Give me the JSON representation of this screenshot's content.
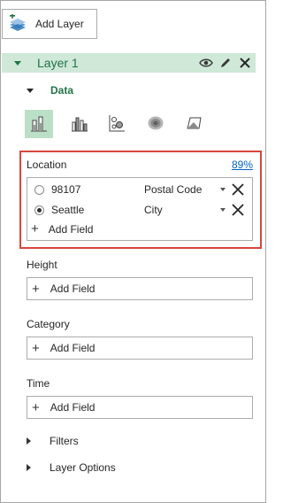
{
  "toolbar": {
    "add_layer_label": "Add Layer"
  },
  "layer": {
    "name": "Layer 1"
  },
  "data_section": {
    "label": "Data"
  },
  "viz_types": [
    {
      "icon": "stacked-column-icon",
      "selected": true
    },
    {
      "icon": "clustered-column-icon",
      "selected": false
    },
    {
      "icon": "bubble-icon",
      "selected": false
    },
    {
      "icon": "heat-map-icon",
      "selected": false
    },
    {
      "icon": "region-icon",
      "selected": false
    }
  ],
  "location": {
    "label": "Location",
    "confidence": "89%",
    "rows": [
      {
        "value": "98107",
        "type": "Postal Code",
        "selected": false
      },
      {
        "value": "Seattle",
        "type": "City",
        "selected": true
      }
    ],
    "add_field": "Add Field"
  },
  "height": {
    "label": "Height",
    "add_field": "Add Field"
  },
  "category": {
    "label": "Category",
    "add_field": "Add Field"
  },
  "time": {
    "label": "Time",
    "add_field": "Add Field"
  },
  "filters": {
    "label": "Filters"
  },
  "layer_options": {
    "label": "Layer Options"
  },
  "colors": {
    "accent": "#217346",
    "layer_bar": "#cfe8d8",
    "highlight": "#d9453e",
    "link": "#0563c1"
  }
}
